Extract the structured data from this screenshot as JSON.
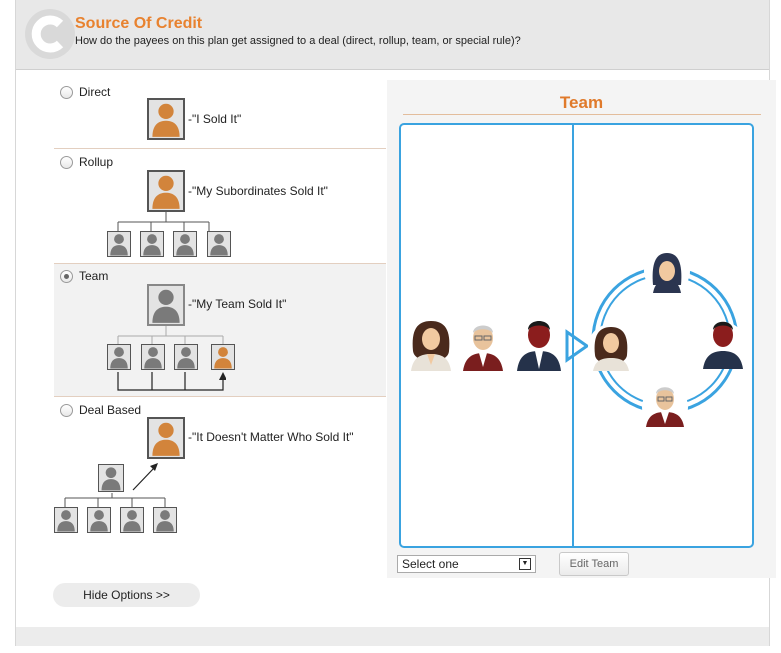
{
  "header": {
    "title": "Source Of Credit",
    "subtitle": "How do the payees on this plan get assigned to a deal (direct, rollup, team, or special rule)?"
  },
  "options": [
    {
      "label": "Direct",
      "quote": "-\"I Sold It\"",
      "selected": false
    },
    {
      "label": "Rollup",
      "quote": "-\"My Subordinates Sold It\"",
      "selected": false
    },
    {
      "label": "Team",
      "quote": "-\"My Team Sold It\"",
      "selected": true
    },
    {
      "label": "Deal Based",
      "quote": "-\"It Doesn't Matter Who Sold It\"",
      "selected": false
    }
  ],
  "panel": {
    "title": "Team",
    "select_value": "Select one",
    "edit_button": "Edit Team"
  },
  "hide_button": "Hide Options >>",
  "colors": {
    "accent": "#e8822f",
    "blue": "#3aa3e0",
    "person_orange": "#d2843b",
    "person_gray": "#7a7a7a"
  }
}
